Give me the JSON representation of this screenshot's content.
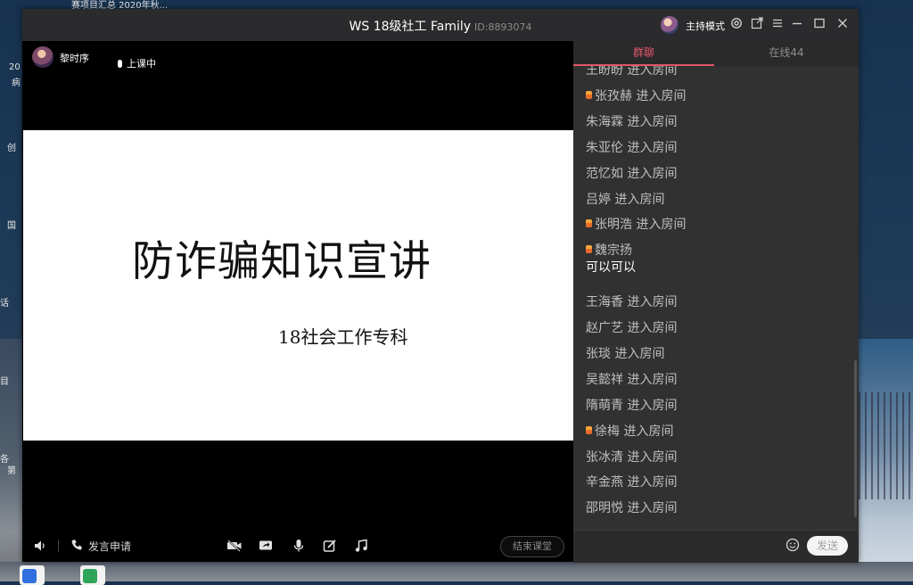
{
  "desktop": {
    "top_text": "赛项目汇总    2020年秋...",
    "left_texts": [
      "20",
      "病",
      "创",
      "国",
      "话",
      "目",
      "各",
      "第"
    ]
  },
  "window": {
    "title": "WS 18级社工 Family",
    "room_id": "ID:8893074",
    "host_mode_label": "主持模式",
    "icons": [
      "settings-icon",
      "popout-icon",
      "menu-icon",
      "minimize-icon",
      "maximize-icon",
      "close-icon"
    ]
  },
  "stage": {
    "presenter_name": "黎时序",
    "mic_status": "上课中",
    "slide": {
      "title": "防诈骗知识宣讲",
      "subtitle": "18社会工作专科"
    }
  },
  "controls": {
    "speak_request_label": "发言申请",
    "end_class_label": "结束课堂",
    "icons": [
      "speaker-icon",
      "phone-icon",
      "camera-off-icon",
      "screen-share-icon",
      "mic-icon",
      "edit-icon",
      "music-icon"
    ]
  },
  "chat": {
    "tabs": [
      {
        "label": "群聊",
        "active": true
      },
      {
        "label": "在线44",
        "active": false
      }
    ],
    "messages": [
      {
        "text": "王盼盼 进入房间",
        "badge": false,
        "type": "join"
      },
      {
        "text": "张孜赫 进入房间",
        "badge": true,
        "type": "join"
      },
      {
        "text": "朱海霖 进入房间",
        "badge": false,
        "type": "join"
      },
      {
        "text": "朱亚伦 进入房间",
        "badge": false,
        "type": "join"
      },
      {
        "text": "范忆如 进入房间",
        "badge": false,
        "type": "join"
      },
      {
        "text": "吕婷 进入房间",
        "badge": false,
        "type": "join"
      },
      {
        "text": "张明浩 进入房间",
        "badge": true,
        "type": "join"
      },
      {
        "text": "魏宗扬",
        "badge": true,
        "type": "sender"
      },
      {
        "text": "可以可以",
        "badge": false,
        "type": "message"
      },
      {
        "text": "王海香 进入房间",
        "badge": false,
        "type": "join"
      },
      {
        "text": "赵广艺 进入房间",
        "badge": false,
        "type": "join"
      },
      {
        "text": "张琰 进入房间",
        "badge": false,
        "type": "join"
      },
      {
        "text": "吴懿祥 进入房间",
        "badge": false,
        "type": "join"
      },
      {
        "text": "隋萌青 进入房间",
        "badge": false,
        "type": "join"
      },
      {
        "text": "徐梅 进入房间",
        "badge": true,
        "type": "join"
      },
      {
        "text": "张冰清 进入房间",
        "badge": false,
        "type": "join"
      },
      {
        "text": "辛金燕 进入房间",
        "badge": false,
        "type": "join"
      },
      {
        "text": "邵明悦 进入房间",
        "badge": false,
        "type": "join"
      }
    ],
    "input_value": "",
    "send_label": "发送",
    "accent_color": "#e2566b"
  }
}
